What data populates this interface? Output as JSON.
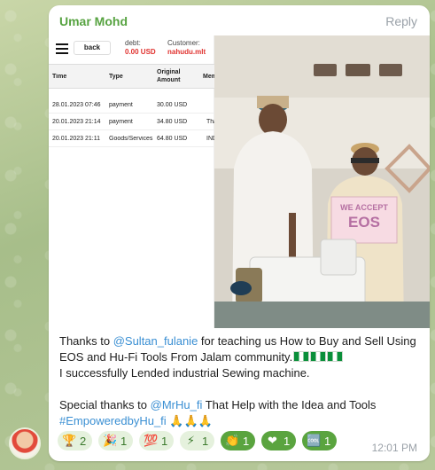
{
  "message": {
    "sender": "Umar Mohd",
    "reply_label": "Reply",
    "time": "12:01 PM"
  },
  "screenshot": {
    "back_label": "back",
    "debt_label": "debt:",
    "debt_value": "0.00 USD",
    "customer_label": "Customer:",
    "customer_value": "nahudu.mlt",
    "columns": [
      "Time",
      "Type",
      "Original Amount",
      "Mem"
    ],
    "rows": [
      {
        "time": "28.01.2023 07:46",
        "type": "payment",
        "amount": "30.00 USD",
        "memo": ""
      },
      {
        "time": "20.01.2023 21:14",
        "type": "payment",
        "amount": "34.80 USD",
        "memo": "Tha"
      },
      {
        "time": "20.01.2023 21:11",
        "type": "Goods/Services",
        "amount": "64.80 USD",
        "memo": "IND"
      }
    ]
  },
  "photo": {
    "sign_line1": "WE ACCEPT",
    "sign_line2": "EOS"
  },
  "caption": {
    "p1_a": "Thanks to ",
    "p1_mention": "@Sultan_fulanie",
    "p1_b": " for teaching us How to Buy and Sell Using EOS and Hu-Fi Tools  From Jalam community.",
    "p1_c": "I successfully Lended industrial Sewing machine.",
    "p2_a": "Special thanks to ",
    "p2_mention": "@MrHu_fi",
    "p2_b": " That Help with the Idea and Tools",
    "p2_hashtag": "#EmpoweredbyHu_fi",
    "p2_emoji": "🙏🙏🙏"
  },
  "reactions": [
    {
      "emoji": "🏆",
      "count": "2",
      "selected": false
    },
    {
      "emoji": "🎉",
      "count": "1",
      "selected": false
    },
    {
      "emoji": "💯",
      "count": "1",
      "selected": false
    },
    {
      "emoji": "⚡",
      "count": "1",
      "selected": false
    },
    {
      "emoji": "👏",
      "count": "1",
      "selected": true
    },
    {
      "emoji": "❤",
      "count": "1",
      "selected": true
    },
    {
      "emoji": "🆒",
      "count": "1",
      "selected": true
    }
  ],
  "colors": {
    "sender": "#57a341",
    "mention": "#3a8fd3",
    "reaction_selected": "#5aa43f",
    "reaction_default": "#e5f1dd"
  }
}
